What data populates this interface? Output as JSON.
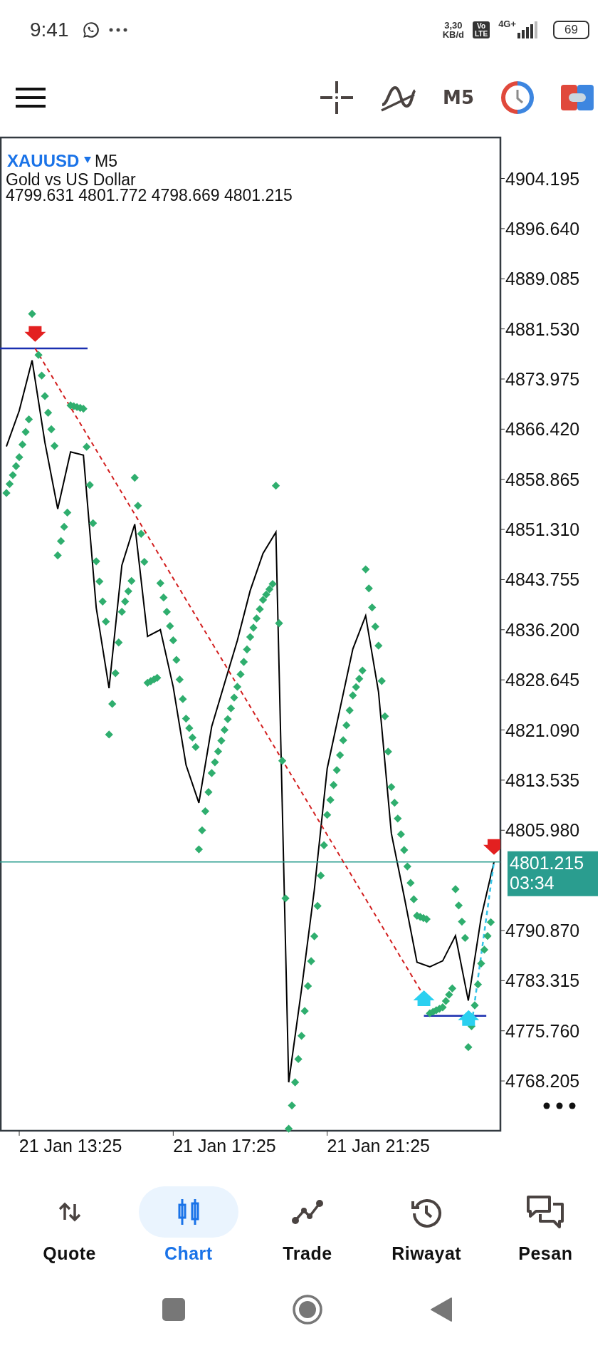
{
  "status_bar": {
    "time": "9:41",
    "speed": "3,30",
    "speed_unit": "KB/d",
    "volte_top": "Vo",
    "volte_bottom": "LTE",
    "network": "4G+",
    "battery": "69"
  },
  "toolbar": {
    "timeframe": "M5"
  },
  "chart": {
    "symbol": "XAUUSD",
    "timeframe": "M5",
    "description": "Gold vs US Dollar",
    "ohlc": "4799.631 4801.772 4798.669 4801.215",
    "current_price": "4801.215",
    "countdown": "03:34",
    "chart_data": {
      "type": "line",
      "categories": [
        null,
        null,
        null,
        null,
        null,
        "21 Jan 13:25",
        null,
        null,
        null,
        null,
        null,
        null,
        null,
        null,
        null,
        null,
        null,
        "21 Jan 17:25",
        null,
        null,
        null,
        null,
        null,
        null,
        null,
        null,
        null,
        null,
        null,
        "21 Jan 21:25",
        null,
        null,
        null,
        null,
        null,
        null,
        null,
        null,
        null
      ],
      "series": [
        {
          "color": "#000000",
          "values": [
            4863.8,
            4869.2,
            4876.8,
            4864.4,
            4854.4,
            4863.0,
            4862.5,
            4839.5,
            4827.4,
            4845.9,
            4852.1,
            4835.2,
            4836.2,
            4827.6,
            4815.8,
            4810.1,
            4821.6,
            4828.1,
            4834.6,
            4842.1,
            4847.7,
            4850.9,
            4768.0,
            4782.0,
            4797.0,
            4815.3,
            4824.3,
            4833.3,
            4838.3,
            4826.8,
            4805.5,
            4796.0,
            4786.1,
            4785.4,
            4786.3,
            4790.1,
            4780.3,
            4792.9,
            4801.2
          ]
        }
      ],
      "ylim": [
        4760.7,
        4910.37
      ],
      "yticks": [
        4904.195,
        {
          "value": 4896.64,
          "label": "4896.640"
        },
        4889.085,
        {
          "value": 4881.53,
          "label": "4881.530"
        },
        4873.975,
        {
          "value": 4866.42,
          "label": "4866.420"
        },
        4858.865,
        {
          "value": 4851.31,
          "label": "4851.310"
        },
        4843.755,
        {
          "value": 4836.2,
          "label": "4836.200"
        },
        4828.645,
        {
          "value": 4821.09,
          "label": "4821.090"
        },
        4813.535,
        {
          "value": 4805.98,
          "label": "4805.980"
        },
        {
          "value": 4790.87,
          "label": "4790.870"
        },
        4783.315,
        {
          "value": 4775.76,
          "label": "4775.760"
        },
        4768.205
      ]
    }
  },
  "nav": [
    {
      "label": "Quote",
      "selected": false
    },
    {
      "label": "Chart",
      "selected": true
    },
    {
      "label": "Trade",
      "selected": false
    },
    {
      "label": "Riwayat",
      "selected": false
    },
    {
      "label": "Pesan",
      "selected": false
    }
  ]
}
